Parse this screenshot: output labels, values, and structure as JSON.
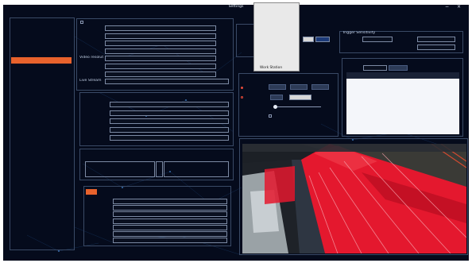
{
  "window": {
    "title": "Settings"
  },
  "sidebar": {
    "header": "",
    "items": [
      "",
      "",
      "",
      "",
      "",
      "",
      "",
      "",
      "",
      "",
      "",
      "",
      "",
      "",
      "",
      "",
      "",
      "",
      "",
      "",
      "",
      "",
      "",
      "",
      "",
      "",
      "",
      "",
      "",
      ""
    ],
    "active_index": 4
  },
  "basic": {
    "title": "",
    "fields": [
      {
        "label": "",
        "value": ""
      },
      {
        "label": "",
        "value": ""
      },
      {
        "label": "",
        "value": ""
      },
      {
        "label": "",
        "value": ""
      },
      {
        "label": "Video resolution",
        "value": ""
      },
      {
        "label": "",
        "value": ""
      },
      {
        "label": "",
        "value": ""
      },
      {
        "label": "Live Stream",
        "value": ""
      }
    ]
  },
  "network": {
    "title": "",
    "fields": [
      {
        "label": "",
        "value": ""
      },
      {
        "label": "",
        "value": ""
      },
      {
        "label": "",
        "value": ""
      },
      {
        "label": "",
        "value": ""
      },
      {
        "label": "",
        "value": ""
      }
    ]
  },
  "area": {
    "title": "",
    "left_title": "",
    "right_title": ""
  },
  "actions": {
    "tabs": [
      "",
      ""
    ],
    "rows": [
      "",
      "",
      "",
      "",
      "",
      "",
      ""
    ]
  },
  "draw": {
    "buttons": [
      "",
      "",
      "",
      ""
    ]
  },
  "trigger": {
    "title": "Trigger Sensitivity",
    "row1_label": "",
    "row1_value": "",
    "row1_right_label": "",
    "row2_label": "",
    "row2_right_label": ""
  },
  "options": {
    "title": "",
    "sub_title": "",
    "radio1": "",
    "buttons": [
      "",
      "",
      ""
    ],
    "row2_label": "",
    "row2_btn": "",
    "row2_value": "",
    "row3_label": "",
    "row4_label": "",
    "row5": [
      "",
      "",
      ""
    ]
  },
  "alarm": {
    "title": "",
    "type_label": "",
    "type_value": "",
    "btn": "",
    "right_label": "",
    "columns": [
      "",
      "",
      "",
      "",
      "",
      ""
    ]
  },
  "preview": {
    "title": "",
    "osd_left": "",
    "osd_right": ""
  },
  "footer": {
    "ok": "",
    "cancel": ""
  },
  "context_menu": {
    "items": [
      "",
      "",
      "",
      "",
      "",
      "",
      "",
      "",
      "",
      "",
      "",
      "",
      "",
      "",
      "Work Station"
    ],
    "selected_index": 8
  },
  "colors": {
    "background": "#050b1c",
    "accent": "#e8622c",
    "overlay": "#e4182e",
    "menu_highlight": "#1e5ad6"
  }
}
